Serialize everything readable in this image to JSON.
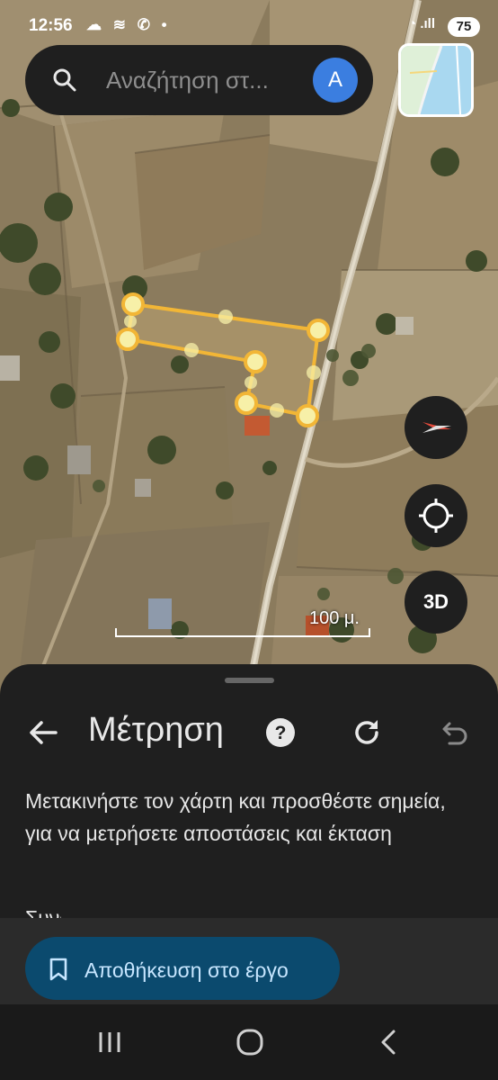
{
  "status_bar": {
    "time": "12:56",
    "left_icons": "☁ ≋ ✆ •",
    "right_icons": "◔ .ıll",
    "battery": "75"
  },
  "search": {
    "placeholder": "Αναζήτηση στ...",
    "avatar_letter": "A"
  },
  "map": {
    "scale_label": "100 μ.",
    "threed_label": "3D",
    "measure_color": "#f2b636",
    "vertex_color": "#f7f0a8"
  },
  "sheet": {
    "title": "Μέτρηση",
    "instructions": "Μετακινήστε τον χάρτη και προσθέστε σημεία, για να μετρήσετε αποστάσεις και έκταση",
    "cut_text": "Συνολική έκταση",
    "save_label": "Αποθήκευση στο έργο"
  },
  "colors": {
    "sheet_bg": "#1f1f1f",
    "save_bg": "#0b4a6e",
    "save_text": "#c7e6ff",
    "avatar": "#3b7ee0"
  }
}
